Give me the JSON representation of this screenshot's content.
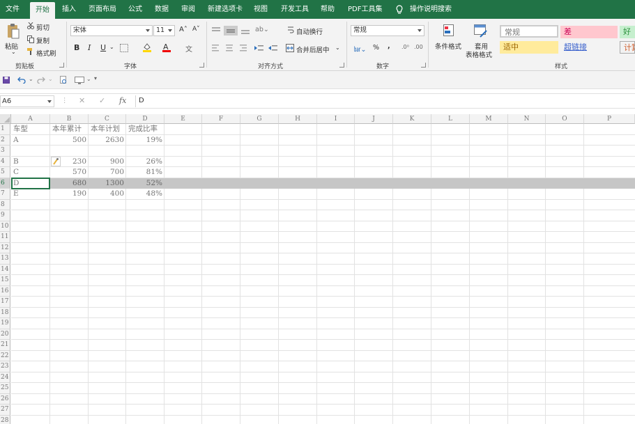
{
  "tabs": [
    {
      "label": "文件",
      "active": false
    },
    {
      "label": "开始",
      "active": true
    },
    {
      "label": "插入",
      "active": false
    },
    {
      "label": "页面布局",
      "active": false
    },
    {
      "label": "公式",
      "active": false
    },
    {
      "label": "数据",
      "active": false
    },
    {
      "label": "审阅",
      "active": false
    },
    {
      "label": "新建选项卡",
      "active": false
    },
    {
      "label": "视图",
      "active": false
    },
    {
      "label": "开发工具",
      "active": false
    },
    {
      "label": "帮助",
      "active": false
    },
    {
      "label": "PDF工具集",
      "active": false
    },
    {
      "label": "操作说明搜索",
      "active": false
    }
  ],
  "clipboard": {
    "paste": "粘贴",
    "cut": "剪切",
    "copy": "复制",
    "format_painter": "格式刷",
    "group": "剪贴板"
  },
  "font": {
    "name": "宋体",
    "size": "11",
    "bold": "B",
    "italic": "I",
    "underline": "U",
    "group": "字体"
  },
  "alignment": {
    "wrap": "自动换行",
    "merge": "合并后居中",
    "group": "对齐方式"
  },
  "number": {
    "format": "常规",
    "percent": "%",
    "comma": ",",
    "group": "数字"
  },
  "styles": {
    "conditional": "条件格式",
    "table_format_1": "套用",
    "table_format_2": "表格格式",
    "normal": "常规",
    "bad": "差",
    "good": "好",
    "neutral": "适中",
    "hyperlink": "超链接",
    "calc": "计算",
    "group": "样式"
  },
  "formula_bar": {
    "name_box": "A6",
    "fx": "fx",
    "value": "D"
  },
  "columns": [
    "A",
    "B",
    "C",
    "D",
    "E",
    "F",
    "G",
    "H",
    "I",
    "J",
    "K",
    "L",
    "M",
    "N",
    "O",
    "P"
  ],
  "rows": [
    "1",
    "2",
    "3",
    "4",
    "5",
    "6",
    "7",
    "8",
    "9",
    "10",
    "11",
    "12",
    "13",
    "14",
    "15",
    "16",
    "17",
    "18",
    "19",
    "20",
    "21",
    "22",
    "23",
    "24",
    "25",
    "26",
    "27",
    "28"
  ],
  "table": {
    "headers": [
      "车型",
      "本年累计",
      "本年计划",
      "完成比率"
    ],
    "rows": [
      [
        "A",
        "500",
        "2630",
        "19%"
      ],
      [
        "",
        "",
        "",
        ""
      ],
      [
        "B",
        "230",
        "900",
        "26%"
      ],
      [
        "C",
        "570",
        "700",
        "81%"
      ],
      [
        "D",
        "680",
        "1300",
        "52%"
      ],
      [
        "E",
        "190",
        "400",
        "48%"
      ]
    ]
  },
  "colors": {
    "ribbon_green": "#217346",
    "selected_row": "#c6c6c6"
  }
}
